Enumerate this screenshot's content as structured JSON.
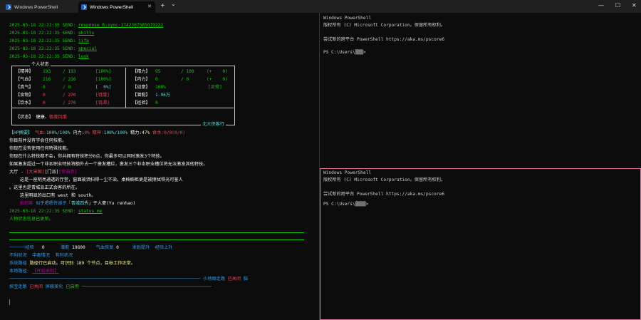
{
  "tabs": [
    {
      "label": "Windows PowerShell"
    },
    {
      "label": "Windows PowerShell"
    }
  ],
  "controls": {
    "new_tab": "+",
    "dropdown": "⌄",
    "minimize": "—",
    "maximize": "☐",
    "close": "✕"
  },
  "left": {
    "send_lines": [
      {
        "ts": "2025-03-18 22:22:35 SEND:",
        "cmd": "response R:sync-1742307585079222"
      },
      {
        "ts": "2025-03-18 22:22:35 SEND:",
        "cmd": "skills"
      },
      {
        "ts": "2025-03-18 22:22:35 SEND:",
        "cmd": "jifa"
      },
      {
        "ts": "2025-03-18 22:22:35 SEND:",
        "cmd": "special"
      },
      {
        "ts": "2025-03-18 22:22:35 SEND:",
        "cmd": "look"
      }
    ],
    "status_box": {
      "title": "个人状态",
      "rows": [
        {
          "k": "【精神】",
          "a": "193",
          "b": "/ 193",
          "p": "[100%]",
          "k2": "【精力】",
          "a2": "95",
          "b2": "/ 100",
          "p2": "(+    0)"
        },
        {
          "k": "【气血】",
          "a": "216",
          "b": "/ 216",
          "p": "[100%]",
          "k2": "【内力】",
          "a2": "0",
          "b2": "/ 0",
          "p2": "(+    0)"
        },
        {
          "k": "【真气】",
          "a": "0",
          "b": "/ 0",
          "p": "[  0%]",
          "k2": "【战意】",
          "a2": "100%",
          "b2": "",
          "p2": "[正常]"
        },
        {
          "k": "【食物】",
          "a": "0",
          "b": "/ 270",
          "p": "[饥饿]",
          "k2": "【潜能】",
          "a2": "1.96万",
          "b2": "",
          "p2": ""
        },
        {
          "k": "【饮水】",
          "a": "0",
          "b": "/ 270",
          "p": "[饥渴]",
          "k2": "【经验】",
          "a2": "0",
          "b2": "",
          "p2": ""
        }
      ],
      "state_label": "【状态】",
      "state_value": "健康、",
      "state_bad": "极度饥饿",
      "footer": "北大侠客行"
    },
    "hp_line": {
      "k": "【HP摘要】",
      "a": "气血:",
      "a_v": "100%/100%",
      "b": "内力:",
      "b_v": "0%",
      "c": "精神:",
      "c_v": "100%/100%",
      "d": "精力:",
      "d_v": "47%",
      "e": "食水:",
      "e_v": "0/0(0/0)"
    },
    "messages": [
      "你目前并没有学会任何技能。",
      "你现在没有使用任何特殊技能。",
      "你现在什么特技都不会，你共拥有特技积分0点，你最多可以同时激发3个特技。",
      "如果激发超过一个非本职业特技将额外占一个激发槽位，激发三个非本职业槽位将无法激发其他特技。"
    ],
    "room": {
      "name": "大厅",
      "sep": " - ",
      "a": "[大宋国]",
      "b": "[门派]",
      "c": "[参悬赤]"
    },
    "room_desc": [
      "    这是一座明亮通透的厅堂，窗面被洒扫得一尘不染。桌椅橱柜更是被擦拭得光可鉴人",
      "。这里也是青城派正式会客的所在。",
      "    这里明显的出口有 west 和 south。"
    ],
    "npc": {
      "pre": "    ",
      "title": "影刺客",
      "mid": " 似乎嗯嗯传弟子「",
      "sect": "青城四秀",
      "post": "」于人豪(Yu renhao)"
    },
    "send_last": {
      "ts": "2025-03-18 22:22:35 SEND:",
      "cmd": "status_me"
    },
    "updated": "人物状态信息已更新。",
    "bar1": {
      "exp_l": "经验",
      "exp_v": "0",
      "pot_l": "潜能",
      "pot_v": "19600",
      "hp_l": "气血恢复",
      "hp_v": "0",
      "fire": "发励提升",
      "exp2": "经验上升"
    },
    "bar2": {
      "a": "不利状况",
      "b": "中毒情况",
      "c": "有利状况"
    },
    "bar3": {
      "l": "系统路径",
      "v": "路径行已启动。可识别 189 个节点，目标工作正常。"
    },
    "bar4": {
      "l": "本地路径",
      "v": "【开始录制】"
    },
    "bar5": {
      "l": "小地图走路",
      "v": "已关闭",
      "s": "脑"
    },
    "bar6": {
      "a": "探宝走路",
      "a_v": "已关闭",
      "b": "屏蔽美化",
      "b_v": "已启用"
    }
  },
  "right_top": [
    "Windows PowerShell",
    "版权所有 (C) Microsoft Corporation。保留所有权利。",
    "",
    "尝试新的跨平台 PowerShell https://aka.ms/pscore6",
    "",
    "PS C:\\Users\\▒▒▒> "
  ],
  "right_bottom": [
    "Windows PowerShell",
    "版权所有 (C) Microsoft Corporation。保留所有权利。",
    "",
    "尝试新的跨平台 PowerShell https://aka.ms/pscore6",
    "",
    "PS C:\\Users\\▒▒▒▒>"
  ]
}
